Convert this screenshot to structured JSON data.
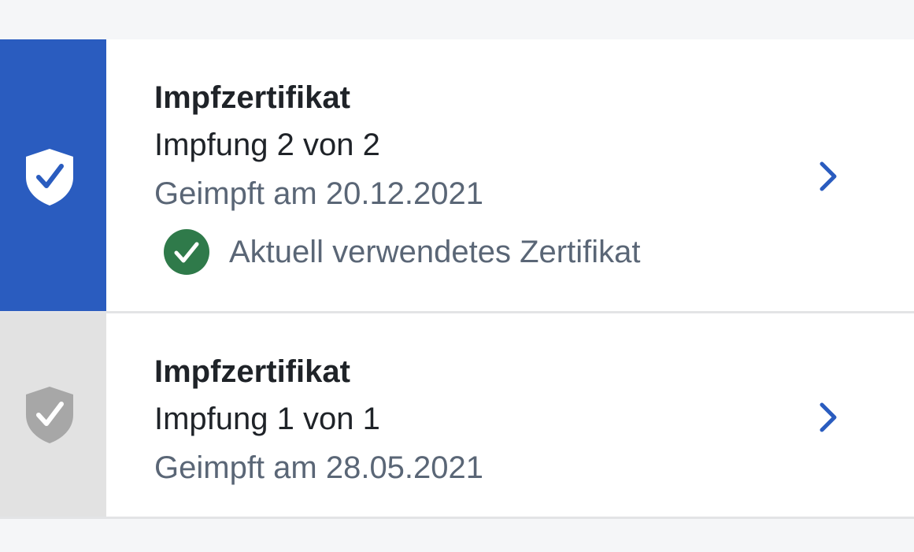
{
  "certificates": [
    {
      "title": "Impfzertifikat",
      "dose": "Impfung 2 von 2",
      "date": "Geimpft am 20.12.2021",
      "current_label": "Aktuell verwendetes Zertifikat",
      "status": "active",
      "stripe_color": "#2a5cbf"
    },
    {
      "title": "Impfzertifikat",
      "dose": "Impfung 1 von 1",
      "date": "Geimpft am 28.05.2021",
      "status": "inactive",
      "stripe_color": "#e2e2e2"
    }
  ],
  "icons": {
    "active_shield": "shield-check-icon",
    "inactive_shield": "shield-check-icon",
    "current_badge": "check-circle-icon",
    "row_chevron": "chevron-right-icon"
  },
  "colors": {
    "accent": "#2a5cbf",
    "success": "#2f7a4a",
    "text_primary": "#1f2328",
    "text_secondary": "#5a6676",
    "background": "#f5f6f8"
  }
}
